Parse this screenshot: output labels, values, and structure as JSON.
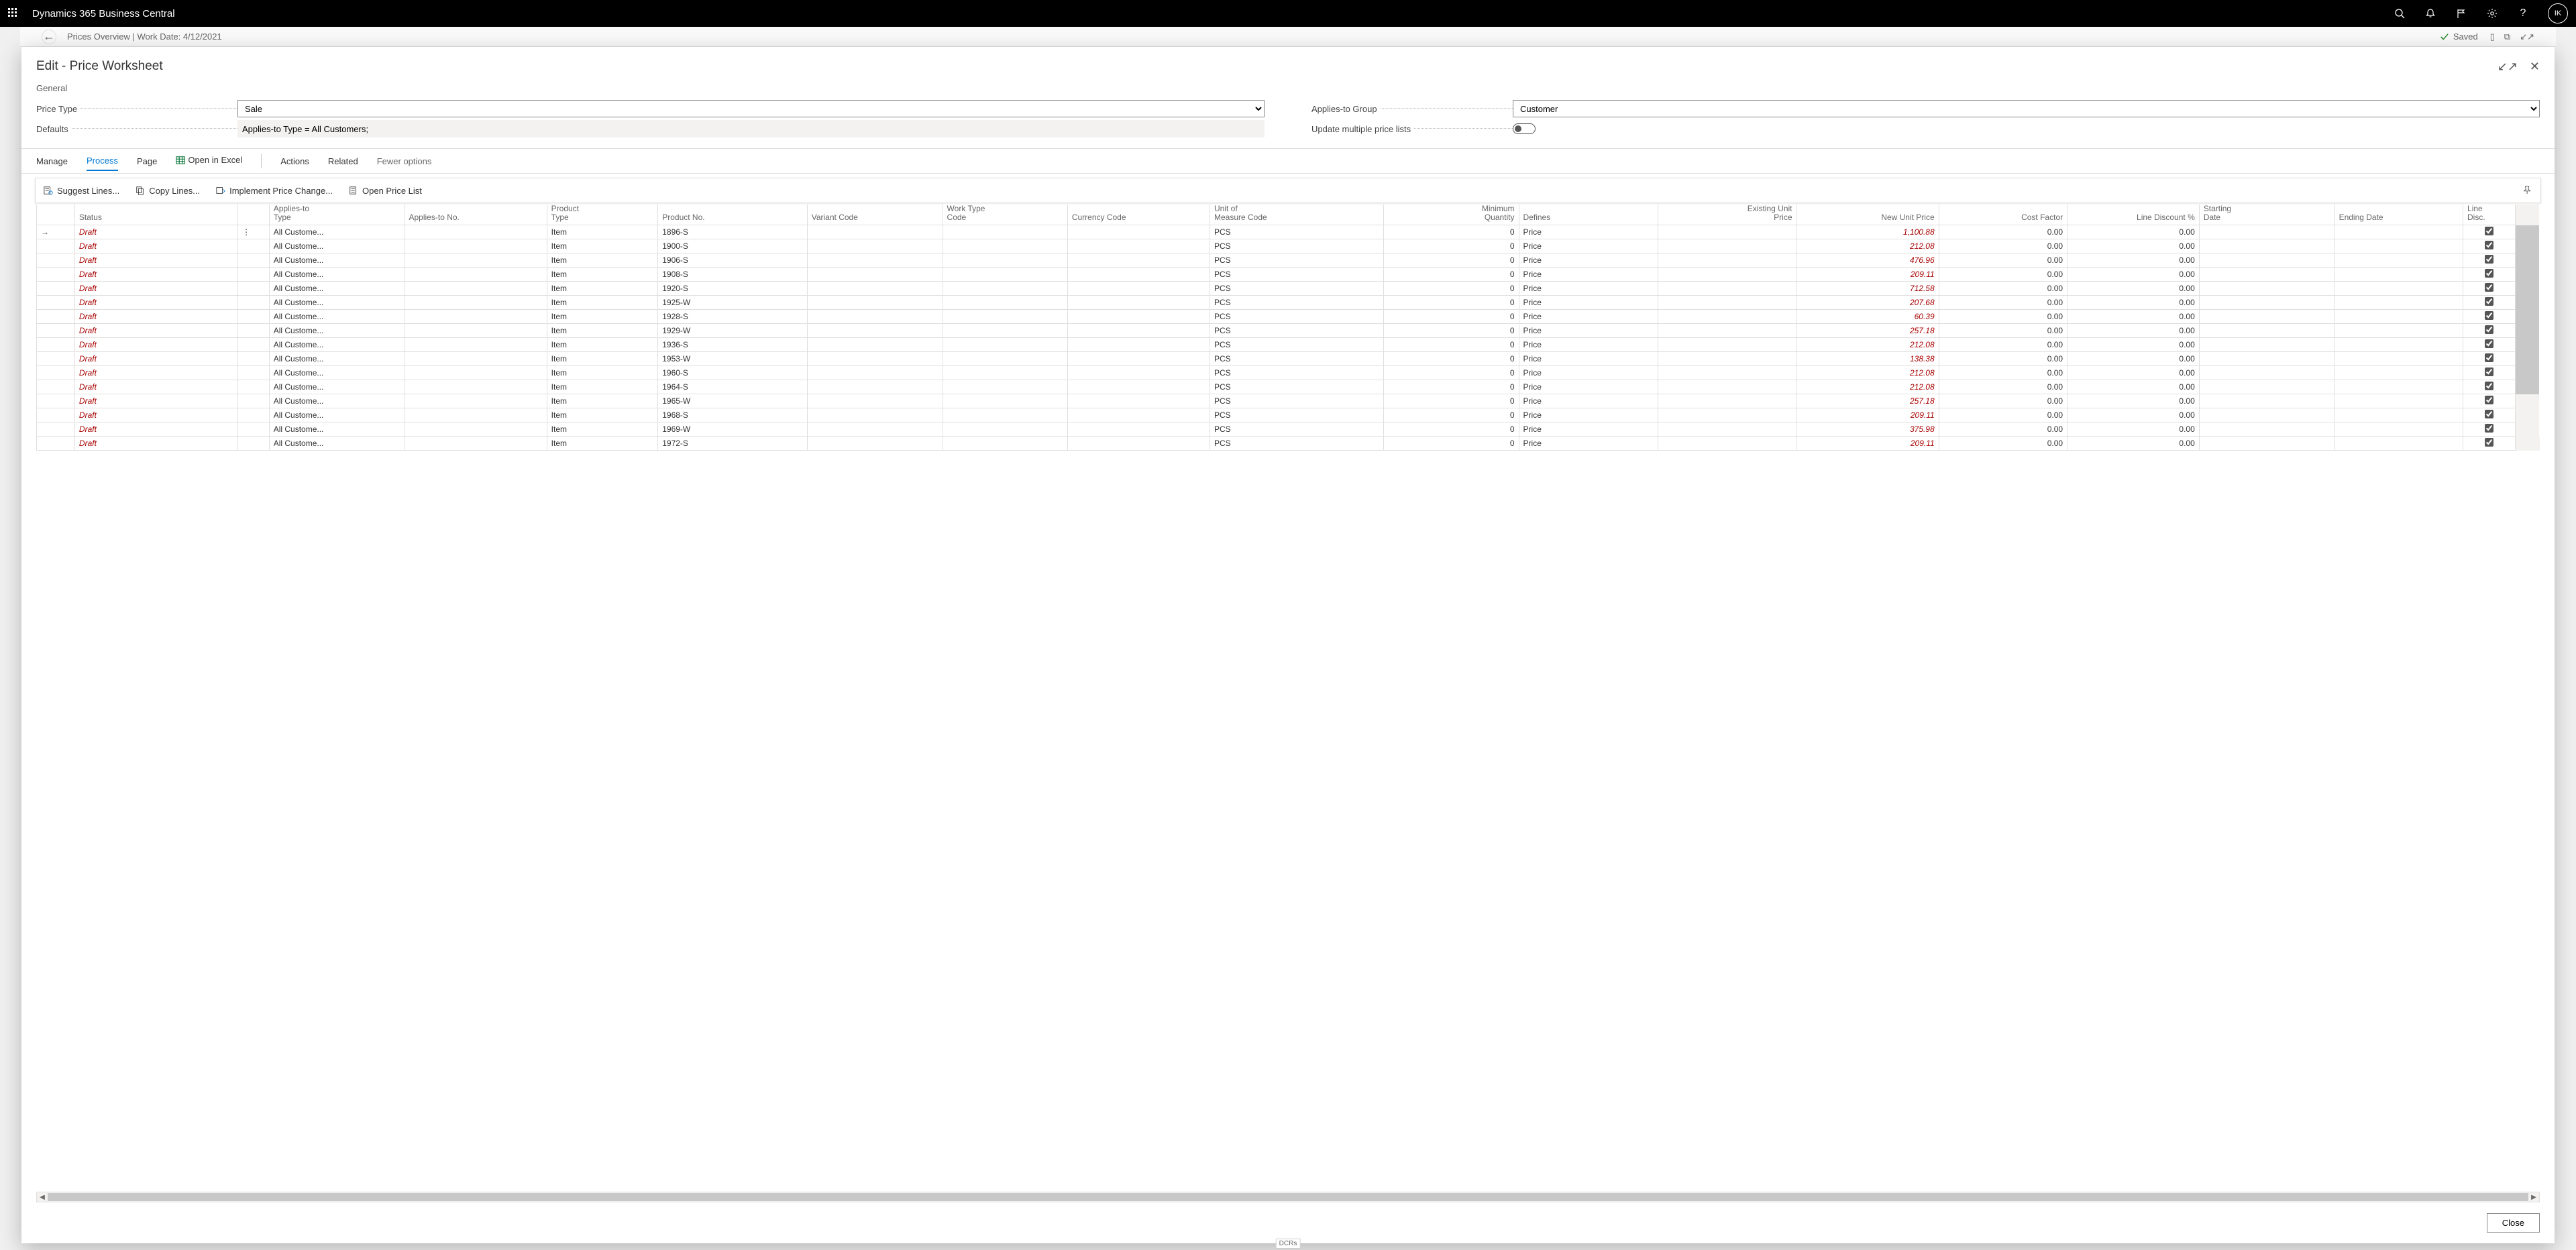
{
  "app": {
    "title": "Dynamics 365 Business Central",
    "userInitials": "IK"
  },
  "background": {
    "breadcrumb": "Prices Overview | Work Date: 4/12/2021",
    "savedLabel": "Saved",
    "footerTag": "DCRs"
  },
  "dialog": {
    "title": "Edit - Price Worksheet",
    "sectionGeneral": "General",
    "fields": {
      "priceTypeLabel": "Price Type",
      "priceTypeValue": "Sale",
      "defaultsLabel": "Defaults",
      "defaultsValue": "Applies-to Type = All Customers;",
      "appliesToGroupLabel": "Applies-to Group",
      "appliesToGroupValue": "Customer",
      "updateMultipleLabel": "Update multiple price lists"
    },
    "menu": {
      "manage": "Manage",
      "process": "Process",
      "page": "Page",
      "openExcel": "Open in Excel",
      "actions": "Actions",
      "related": "Related",
      "fewer": "Fewer options"
    },
    "ribbon": {
      "suggestLines": "Suggest Lines...",
      "copyLines": "Copy Lines...",
      "implement": "Implement Price Change...",
      "openPriceList": "Open Price List"
    },
    "columns": {
      "status": "Status",
      "appliesToType": "Applies-to Type",
      "appliesToNo": "Applies-to No.",
      "productType": "Product Type",
      "productNo": "Product No.",
      "variantCode": "Variant Code",
      "workTypeCode": "Work Type Code",
      "currencyCode": "Currency Code",
      "uomCode": "Unit of Measure Code",
      "minQty": "Minimum Quantity",
      "defines": "Defines",
      "existingUnitPrice": "Existing Unit Price",
      "newUnitPrice": "New Unit Price",
      "costFactor": "Cost Factor",
      "lineDiscPct": "Line Discount %",
      "startingDate": "Starting Date",
      "endingDate": "Ending Date",
      "lineDisc": "Line Disc."
    },
    "rows": [
      {
        "status": "Draft",
        "appliesToType": "All Custome...",
        "productType": "Item",
        "productNo": "1896-S",
        "uom": "PCS",
        "minQty": "0",
        "defines": "Price",
        "newUnitPrice": "1,100.88",
        "costFactor": "0.00",
        "lineDiscPct": "0.00",
        "checked": true
      },
      {
        "status": "Draft",
        "appliesToType": "All Custome...",
        "productType": "Item",
        "productNo": "1900-S",
        "uom": "PCS",
        "minQty": "0",
        "defines": "Price",
        "newUnitPrice": "212.08",
        "costFactor": "0.00",
        "lineDiscPct": "0.00",
        "checked": true
      },
      {
        "status": "Draft",
        "appliesToType": "All Custome...",
        "productType": "Item",
        "productNo": "1906-S",
        "uom": "PCS",
        "minQty": "0",
        "defines": "Price",
        "newUnitPrice": "476.96",
        "costFactor": "0.00",
        "lineDiscPct": "0.00",
        "checked": true
      },
      {
        "status": "Draft",
        "appliesToType": "All Custome...",
        "productType": "Item",
        "productNo": "1908-S",
        "uom": "PCS",
        "minQty": "0",
        "defines": "Price",
        "newUnitPrice": "209.11",
        "costFactor": "0.00",
        "lineDiscPct": "0.00",
        "checked": true
      },
      {
        "status": "Draft",
        "appliesToType": "All Custome...",
        "productType": "Item",
        "productNo": "1920-S",
        "uom": "PCS",
        "minQty": "0",
        "defines": "Price",
        "newUnitPrice": "712.58",
        "costFactor": "0.00",
        "lineDiscPct": "0.00",
        "checked": true
      },
      {
        "status": "Draft",
        "appliesToType": "All Custome...",
        "productType": "Item",
        "productNo": "1925-W",
        "uom": "PCS",
        "minQty": "0",
        "defines": "Price",
        "newUnitPrice": "207.68",
        "costFactor": "0.00",
        "lineDiscPct": "0.00",
        "checked": true
      },
      {
        "status": "Draft",
        "appliesToType": "All Custome...",
        "productType": "Item",
        "productNo": "1928-S",
        "uom": "PCS",
        "minQty": "0",
        "defines": "Price",
        "newUnitPrice": "60.39",
        "costFactor": "0.00",
        "lineDiscPct": "0.00",
        "checked": true
      },
      {
        "status": "Draft",
        "appliesToType": "All Custome...",
        "productType": "Item",
        "productNo": "1929-W",
        "uom": "PCS",
        "minQty": "0",
        "defines": "Price",
        "newUnitPrice": "257.18",
        "costFactor": "0.00",
        "lineDiscPct": "0.00",
        "checked": true
      },
      {
        "status": "Draft",
        "appliesToType": "All Custome...",
        "productType": "Item",
        "productNo": "1936-S",
        "uom": "PCS",
        "minQty": "0",
        "defines": "Price",
        "newUnitPrice": "212.08",
        "costFactor": "0.00",
        "lineDiscPct": "0.00",
        "checked": true
      },
      {
        "status": "Draft",
        "appliesToType": "All Custome...",
        "productType": "Item",
        "productNo": "1953-W",
        "uom": "PCS",
        "minQty": "0",
        "defines": "Price",
        "newUnitPrice": "138.38",
        "costFactor": "0.00",
        "lineDiscPct": "0.00",
        "checked": true
      },
      {
        "status": "Draft",
        "appliesToType": "All Custome...",
        "productType": "Item",
        "productNo": "1960-S",
        "uom": "PCS",
        "minQty": "0",
        "defines": "Price",
        "newUnitPrice": "212.08",
        "costFactor": "0.00",
        "lineDiscPct": "0.00",
        "checked": true
      },
      {
        "status": "Draft",
        "appliesToType": "All Custome...",
        "productType": "Item",
        "productNo": "1964-S",
        "uom": "PCS",
        "minQty": "0",
        "defines": "Price",
        "newUnitPrice": "212.08",
        "costFactor": "0.00",
        "lineDiscPct": "0.00",
        "checked": true
      },
      {
        "status": "Draft",
        "appliesToType": "All Custome...",
        "productType": "Item",
        "productNo": "1965-W",
        "uom": "PCS",
        "minQty": "0",
        "defines": "Price",
        "newUnitPrice": "257.18",
        "costFactor": "0.00",
        "lineDiscPct": "0.00",
        "checked": true
      },
      {
        "status": "Draft",
        "appliesToType": "All Custome...",
        "productType": "Item",
        "productNo": "1968-S",
        "uom": "PCS",
        "minQty": "0",
        "defines": "Price",
        "newUnitPrice": "209.11",
        "costFactor": "0.00",
        "lineDiscPct": "0.00",
        "checked": true
      },
      {
        "status": "Draft",
        "appliesToType": "All Custome...",
        "productType": "Item",
        "productNo": "1969-W",
        "uom": "PCS",
        "minQty": "0",
        "defines": "Price",
        "newUnitPrice": "375.98",
        "costFactor": "0.00",
        "lineDiscPct": "0.00",
        "checked": true
      },
      {
        "status": "Draft",
        "appliesToType": "All Custome...",
        "productType": "Item",
        "productNo": "1972-S",
        "uom": "PCS",
        "minQty": "0",
        "defines": "Price",
        "newUnitPrice": "209.11",
        "costFactor": "0.00",
        "lineDiscPct": "0.00",
        "checked": true
      }
    ],
    "closeLabel": "Close"
  }
}
